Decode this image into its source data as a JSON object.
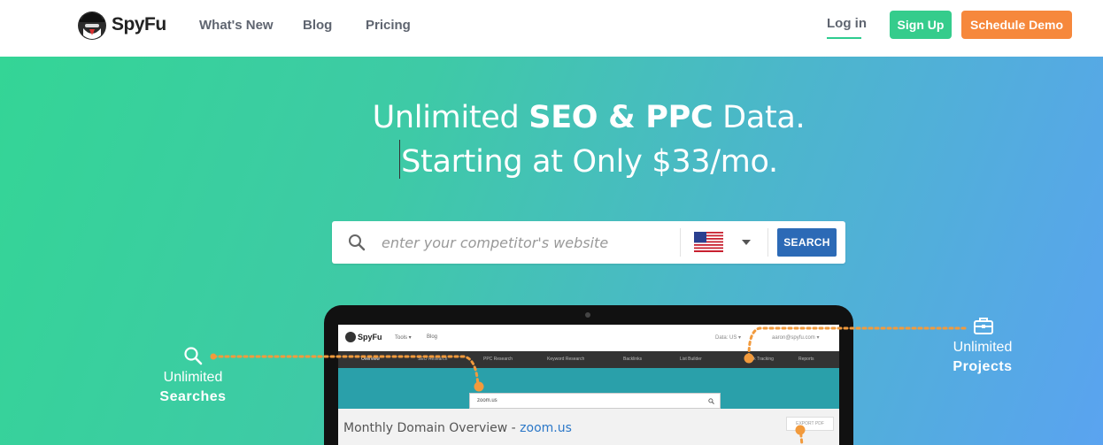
{
  "nav": {
    "brand": "SpyFu",
    "links": [
      "What's New",
      "Blog",
      "Pricing"
    ],
    "login": "Log in",
    "signup": "Sign Up",
    "demo": "Schedule Demo"
  },
  "hero": {
    "headline_1_pre": "Unlimited ",
    "headline_1_bold": "SEO & PPC",
    "headline_1_post": " Data.",
    "headline_2": "Starting at Only $33/mo.",
    "search_placeholder": "enter your competitor's website",
    "search_button": "SEARCH",
    "country": "us-flag"
  },
  "callouts": {
    "left_line1": "Unlimited",
    "left_line2": "Searches",
    "right_line1": "Unlimited",
    "right_line2": "Projects"
  },
  "screen": {
    "brand": "SpyFu",
    "nav_tools": "Tools ▾",
    "nav_blog": "Blog",
    "nav_right": "Data: US ▾",
    "nav_account": "aaron@spyfu.com ▾",
    "tabs": [
      "Overview",
      "SEO Research",
      "PPC Research",
      "Keyword Research",
      "Backlinks",
      "List Builder",
      "Rank Tracking",
      "Reports"
    ],
    "search_value": "zoom.us",
    "overview_title": "Monthly Domain Overview - ",
    "overview_link": "zoom.us",
    "export": "EXPORT PDF"
  },
  "colors": {
    "accent_green": "#35cc8c",
    "accent_orange": "#f6883c",
    "search_blue": "#2c6ab6",
    "dot_orange": "#f29a3c"
  }
}
